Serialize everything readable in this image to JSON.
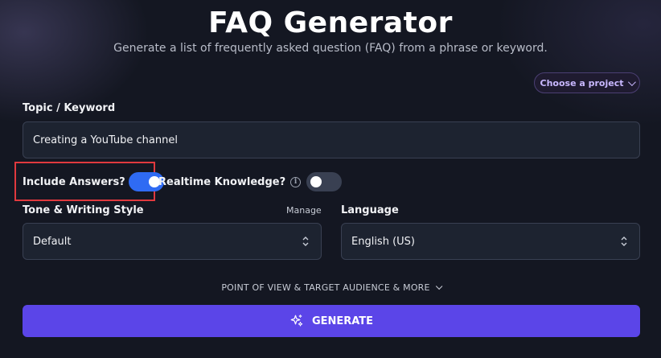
{
  "header": {
    "title": "FAQ Generator",
    "subtitle": "Generate a list of frequently asked question (FAQ) from a phrase or keyword."
  },
  "project_selector": {
    "label": "Choose a project"
  },
  "topic": {
    "label": "Topic / Keyword",
    "value": "Creating a YouTube channel"
  },
  "toggles": {
    "include_answers": {
      "label": "Include Answers?",
      "on": true
    },
    "realtime_knowledge": {
      "label": "Realtime Knowledge?",
      "on": false
    }
  },
  "tone": {
    "label": "Tone & Writing Style",
    "manage_label": "Manage",
    "value": "Default"
  },
  "language": {
    "label": "Language",
    "value": "English (US)"
  },
  "more_options": {
    "label": "POINT OF VIEW & TARGET AUDIENCE & MORE"
  },
  "generate": {
    "label": "GENERATE"
  },
  "colors": {
    "background": "#141722",
    "accent": "#5b45e8",
    "toggle_on": "#2f6bf3",
    "highlight_border": "#e0393e"
  }
}
